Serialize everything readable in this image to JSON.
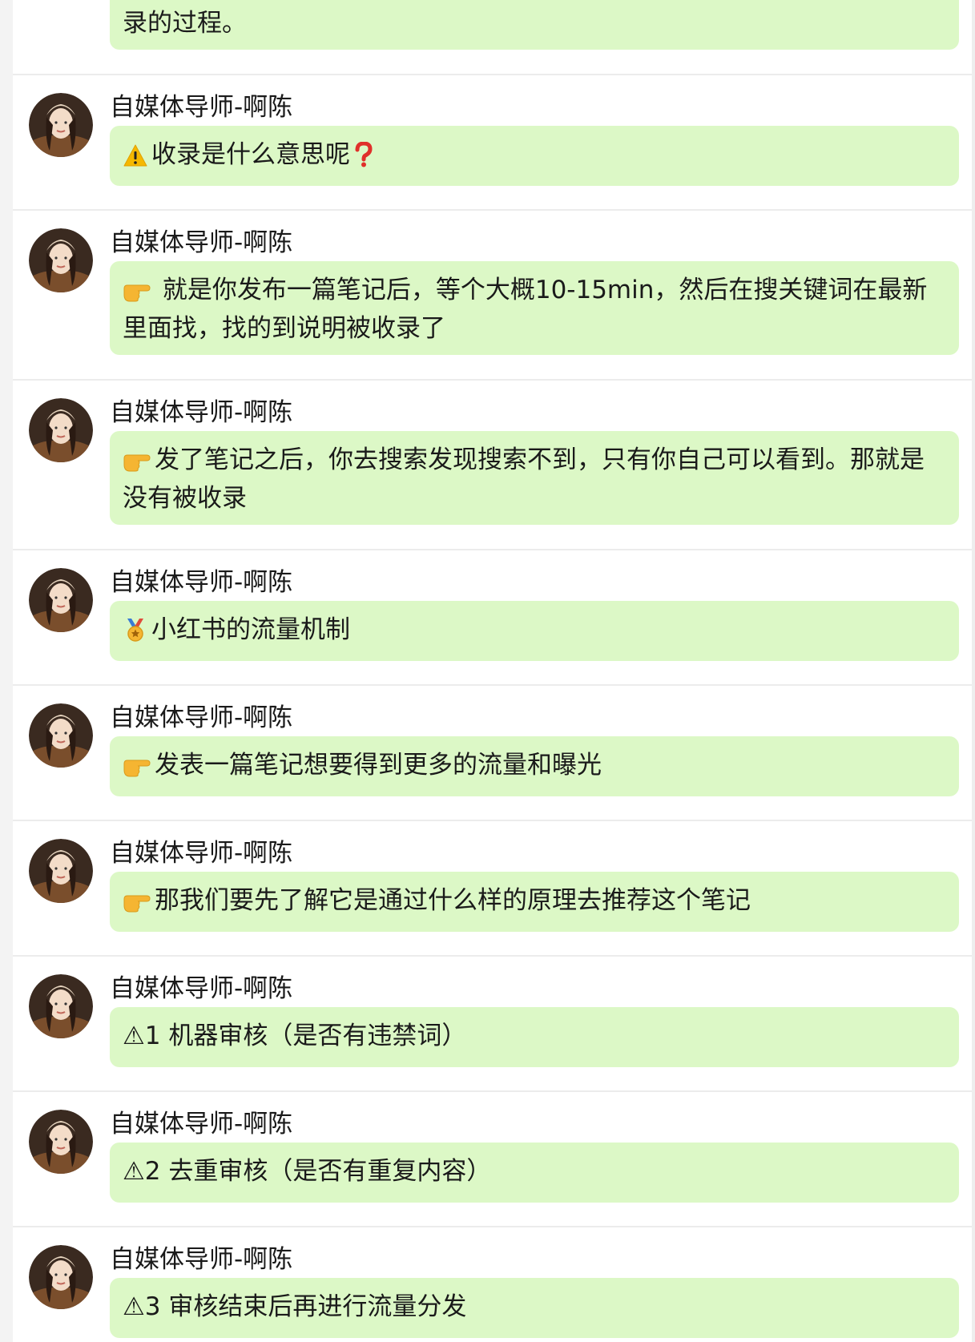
{
  "sender_name": "自媒体导师-啊陈",
  "colors": {
    "bubble": "#dcf8c6",
    "text": "#1a1a1a",
    "divider": "#ececec"
  },
  "top_partial": {
    "text": "录的过程。"
  },
  "messages": [
    {
      "icon": "warning-icon",
      "text": "收录是什么意思呢",
      "trailing_icon": "question-mark-icon"
    },
    {
      "icon": "pointing-hand-icon",
      "text": " 就是你发布一篇笔记后，等个大概10-15min，然后在搜关键词在最新里面找，找的到说明被收录了"
    },
    {
      "icon": "pointing-hand-icon",
      "text": "发了笔记之后，你去搜索发现搜索不到，只有你自己可以看到。那就是没有被收录"
    },
    {
      "icon": "medal-icon",
      "text": "小红书的流量机制"
    },
    {
      "icon": "pointing-hand-icon",
      "text": "发表一篇笔记想要得到更多的流量和曝光"
    },
    {
      "icon": "pointing-hand-icon",
      "text": "那我们要先了解它是通过什么样的原理去推荐这个笔记"
    },
    {
      "icon": "none",
      "text": "⚠1 机器审核（是否有违禁词）"
    },
    {
      "icon": "none",
      "text": "⚠2 去重审核（是否有重复内容）"
    },
    {
      "icon": "none",
      "text": "⚠3 审核结束后再进行流量分发"
    }
  ]
}
